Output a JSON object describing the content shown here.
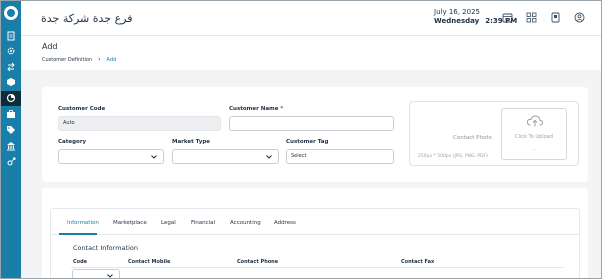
{
  "header": {
    "branch_name": "فرع جدة شركة جدة",
    "date": "July 16, 2025",
    "day": "Wednesday",
    "time": "2:39 PM",
    "icons": [
      "calendar-icon",
      "grid-apps-icon",
      "book-icon",
      "user-icon"
    ]
  },
  "sidebar": {
    "icons": [
      "logo-icon",
      "document-icon",
      "gear-icon",
      "transfer-icon",
      "box-icon",
      "pie-chart-icon",
      "briefcase-icon",
      "tag-icon",
      "bank-icon",
      "settings-arrows-icon"
    ],
    "active_index": 5
  },
  "page": {
    "title": "Add",
    "breadcrumb": [
      "Customer Definition",
      "Add"
    ]
  },
  "form": {
    "customer_code_label": "Customer Code",
    "customer_code_value": "Auto",
    "customer_name_label": "Customer Name",
    "required_mark": "*",
    "category_label": "Category",
    "market_type_label": "Market Type",
    "customer_tag_label": "Customer Tag",
    "customer_tag_value": "Select"
  },
  "photo": {
    "title": "Contact Photo",
    "hint": "250px * 500px (JPG, PNG, PDF)",
    "upload_label": "Click To Upload",
    "upload_mark": "-"
  },
  "tabs": [
    "Information",
    "Marketplace",
    "Legal",
    "Financial",
    "Accounting",
    "Address"
  ],
  "active_tab": "Information",
  "contact": {
    "section_title": "Contact Information",
    "columns": [
      "Code",
      "Contact Mobile",
      "Contact Phone",
      "Contact Fax"
    ]
  },
  "colors": {
    "sidebar": "#1a7fa8",
    "sidebar_active": "#0e2c3a",
    "accent": "#1a7fa8"
  }
}
